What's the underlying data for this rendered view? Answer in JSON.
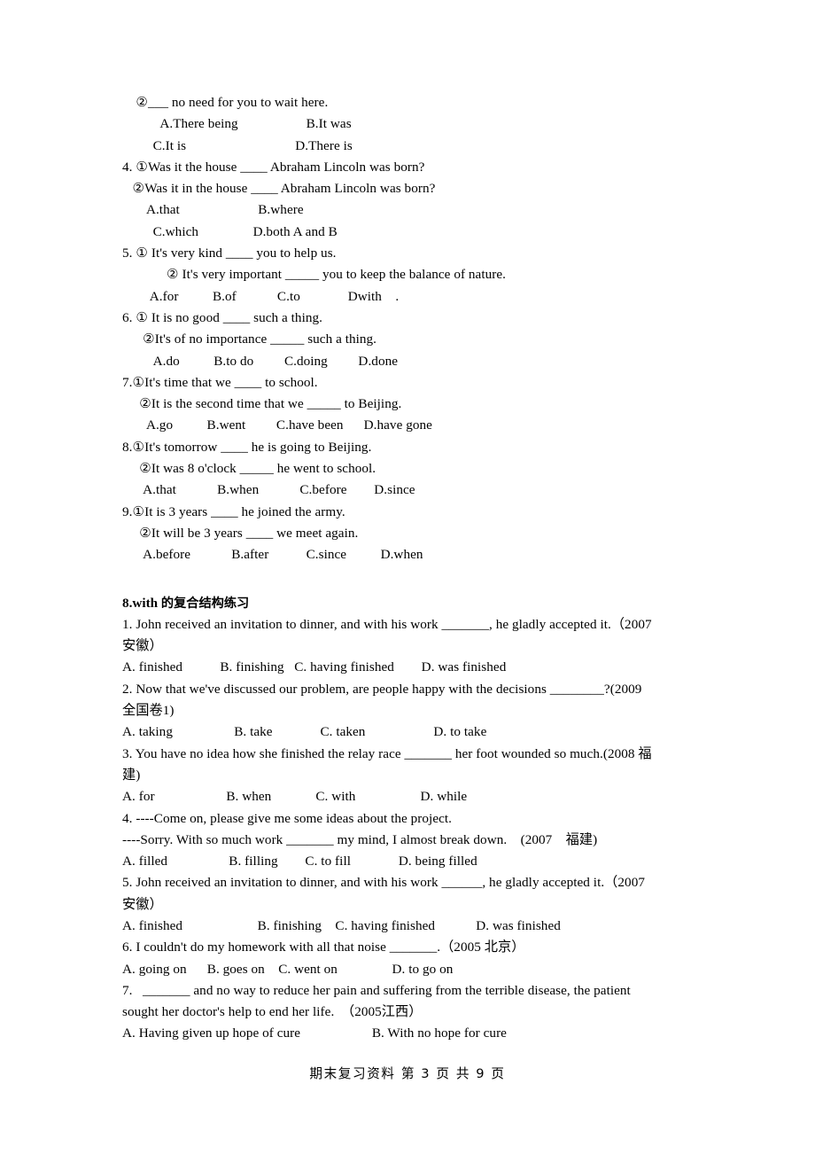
{
  "document": {
    "page_background": "#ffffff",
    "text_color": "#000000",
    "footer": "期末复习资料  第 3 页  共 9 页",
    "footer_parts": {
      "title": "期末复习资料",
      "page_word": "第",
      "page_number": "3",
      "page_unit": "页",
      "total_word": "共",
      "total_number": "9",
      "total_unit": "页"
    }
  },
  "section_top": {
    "lines": [
      "    ②___ no need for you to wait here.",
      "           A.There being                    B.It was",
      "         C.It is                                D.There is",
      "4. ①Was it the house ____ Abraham Lincoln was born?",
      "   ②Was it in the house ____ Abraham Lincoln was born?",
      "       A.that                       B.where",
      "         C.which                D.both A and B",
      "5. ① It's very kind ____ you to help us.",
      "             ② It's very important _____ you to keep the balance of nature.",
      "        A.for          B.of            C.to              Dwith    .",
      "6. ① It is no good ____ such a thing.",
      "      ②It's of no importance _____ such a thing.",
      "         A.do          B.to do         C.doing         D.done",
      "7.①It's time that we ____ to school.",
      "     ②It is the second time that we _____ to Beijing.",
      "       A.go          B.went         C.have been      D.have gone",
      "8.①It's tomorrow ____ he is going to Beijing.",
      "     ②It was 8 o'clock _____ he went to school.",
      "      A.that            B.when            C.before        D.since",
      "9.①It is 3 years ____ he joined the army.",
      "     ②It will be 3 years ____ we meet again.",
      "      A.before            B.after           C.since          D.when"
    ]
  },
  "section_with": {
    "heading": "8.with 的复合结构练习",
    "heading_parts": {
      "number": "8.with",
      "chinese": "的复合结构练习"
    },
    "lines": [
      "1. John received an invitation to dinner, and with his work _______, he gladly accepted it.（2007",
      "安徽）",
      "A. finished           B. finishing   C. having finished        D. was finished",
      "2. Now that we've discussed our problem, are people happy with the decisions ________?(2009",
      "全国卷1)",
      "A. taking                  B. take              C. taken                    D. to take",
      "3. You have no idea how she finished the relay race _______ her foot wounded so much.(2008 福",
      "建)",
      "A. for                     B. when             C. with                   D. while",
      "4. ----Come on, please give me some ideas about the project.",
      "----Sorry. With so much work _______ my mind, I almost break down.    (2007    福建)",
      "A. filled                  B. filling        C. to fill              D. being filled",
      "5. John received an invitation to dinner, and with his work ______, he gladly accepted it.（2007",
      "安徽）",
      "A. finished                      B. finishing    C. having finished            D. was finished",
      "6. I couldn't do my homework with all that noise _______.（2005 北京）",
      "A. going on      B. goes on    C. went on                D. to go on",
      "7.   _______ and no way to reduce her pain and suffering from the terrible disease, the patient",
      "sought her doctor's help to end her life.  （2005江西）",
      "A. Having given up hope of cure                     B. With no hope for cure"
    ]
  }
}
